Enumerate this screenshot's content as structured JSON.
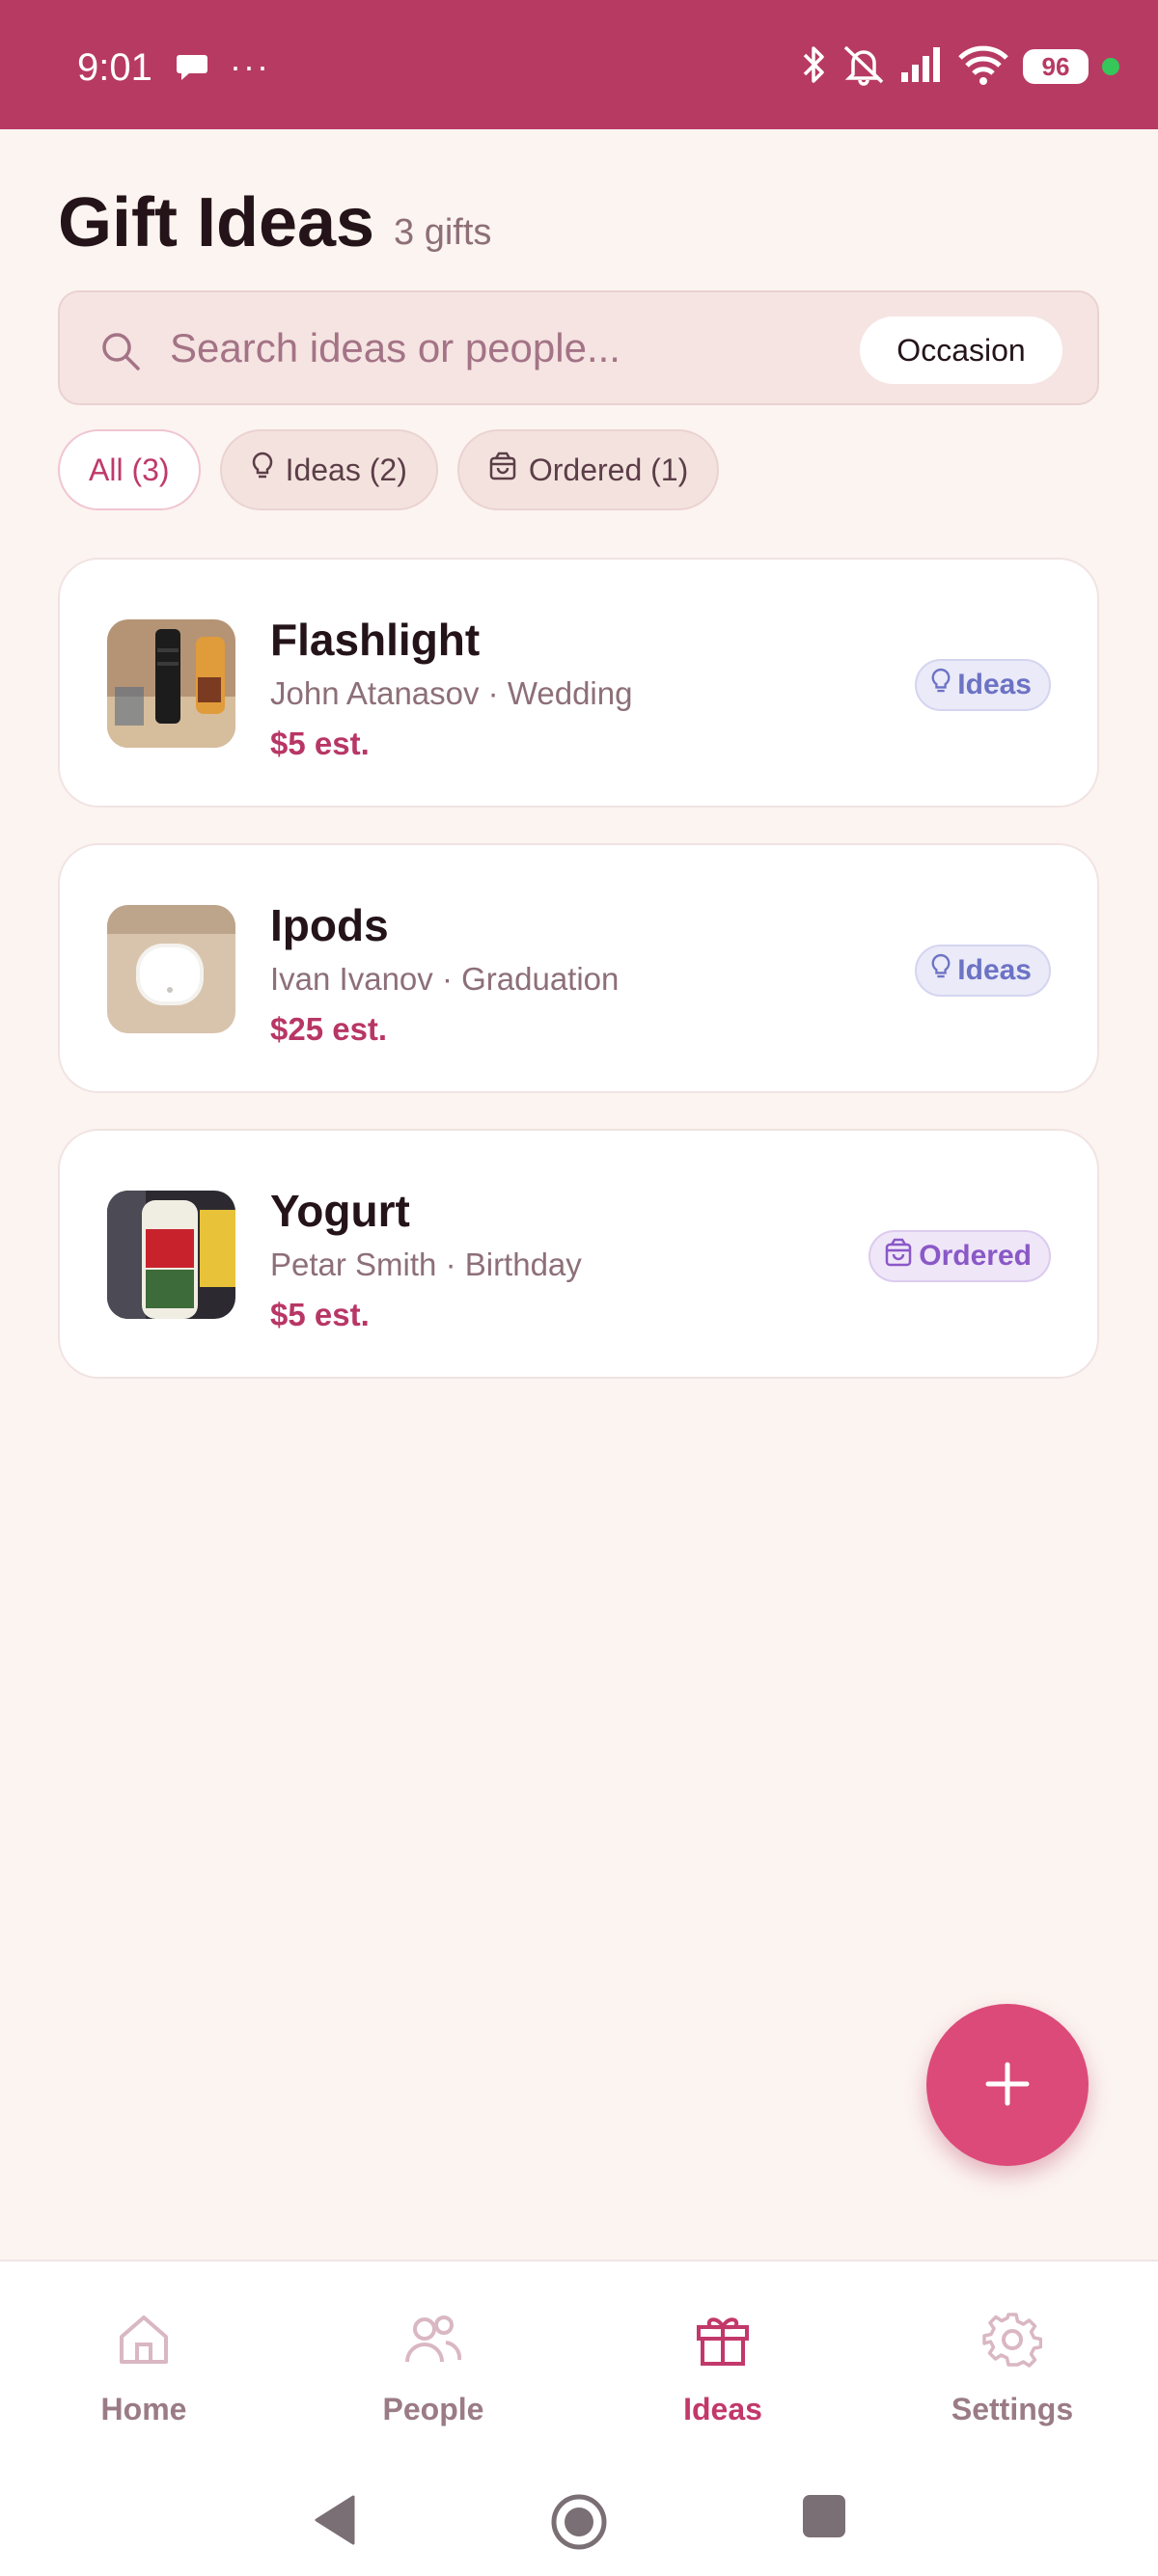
{
  "status_bar": {
    "time": "9:01",
    "dots": "···",
    "battery": "96"
  },
  "header": {
    "title": "Gift Ideas",
    "count": "3 gifts"
  },
  "search": {
    "placeholder": "Search ideas or people...",
    "occasion_label": "Occasion"
  },
  "filters": [
    {
      "label": "All (3)",
      "active": true
    },
    {
      "label": "Ideas (2)",
      "icon": "lightbulb-icon",
      "active": false
    },
    {
      "label": "Ordered (1)",
      "icon": "shopping-bag-icon",
      "active": false
    }
  ],
  "gifts": [
    {
      "name": "Flashlight",
      "recipient": "John Atanasov · Wedding",
      "price": "$5 est.",
      "status": "Ideas",
      "status_icon": "lightbulb-icon"
    },
    {
      "name": "Ipods",
      "recipient": "Ivan Ivanov · Graduation",
      "price": "$25 est.",
      "status": "Ideas",
      "status_icon": "lightbulb-icon"
    },
    {
      "name": "Yogurt",
      "recipient": "Petar Smith · Birthday",
      "price": "$5 est.",
      "status": "Ordered",
      "status_icon": "shopping-bag-icon"
    }
  ],
  "nav": [
    {
      "label": "Home",
      "icon": "home-icon",
      "active": false
    },
    {
      "label": "People",
      "icon": "people-icon",
      "active": false
    },
    {
      "label": "Ideas",
      "icon": "gift-icon",
      "active": true
    },
    {
      "label": "Settings",
      "icon": "gear-icon",
      "active": false
    }
  ],
  "colors": {
    "primary": "#b73a63",
    "accent": "#dc4a79",
    "background": "#fcf4f0"
  }
}
